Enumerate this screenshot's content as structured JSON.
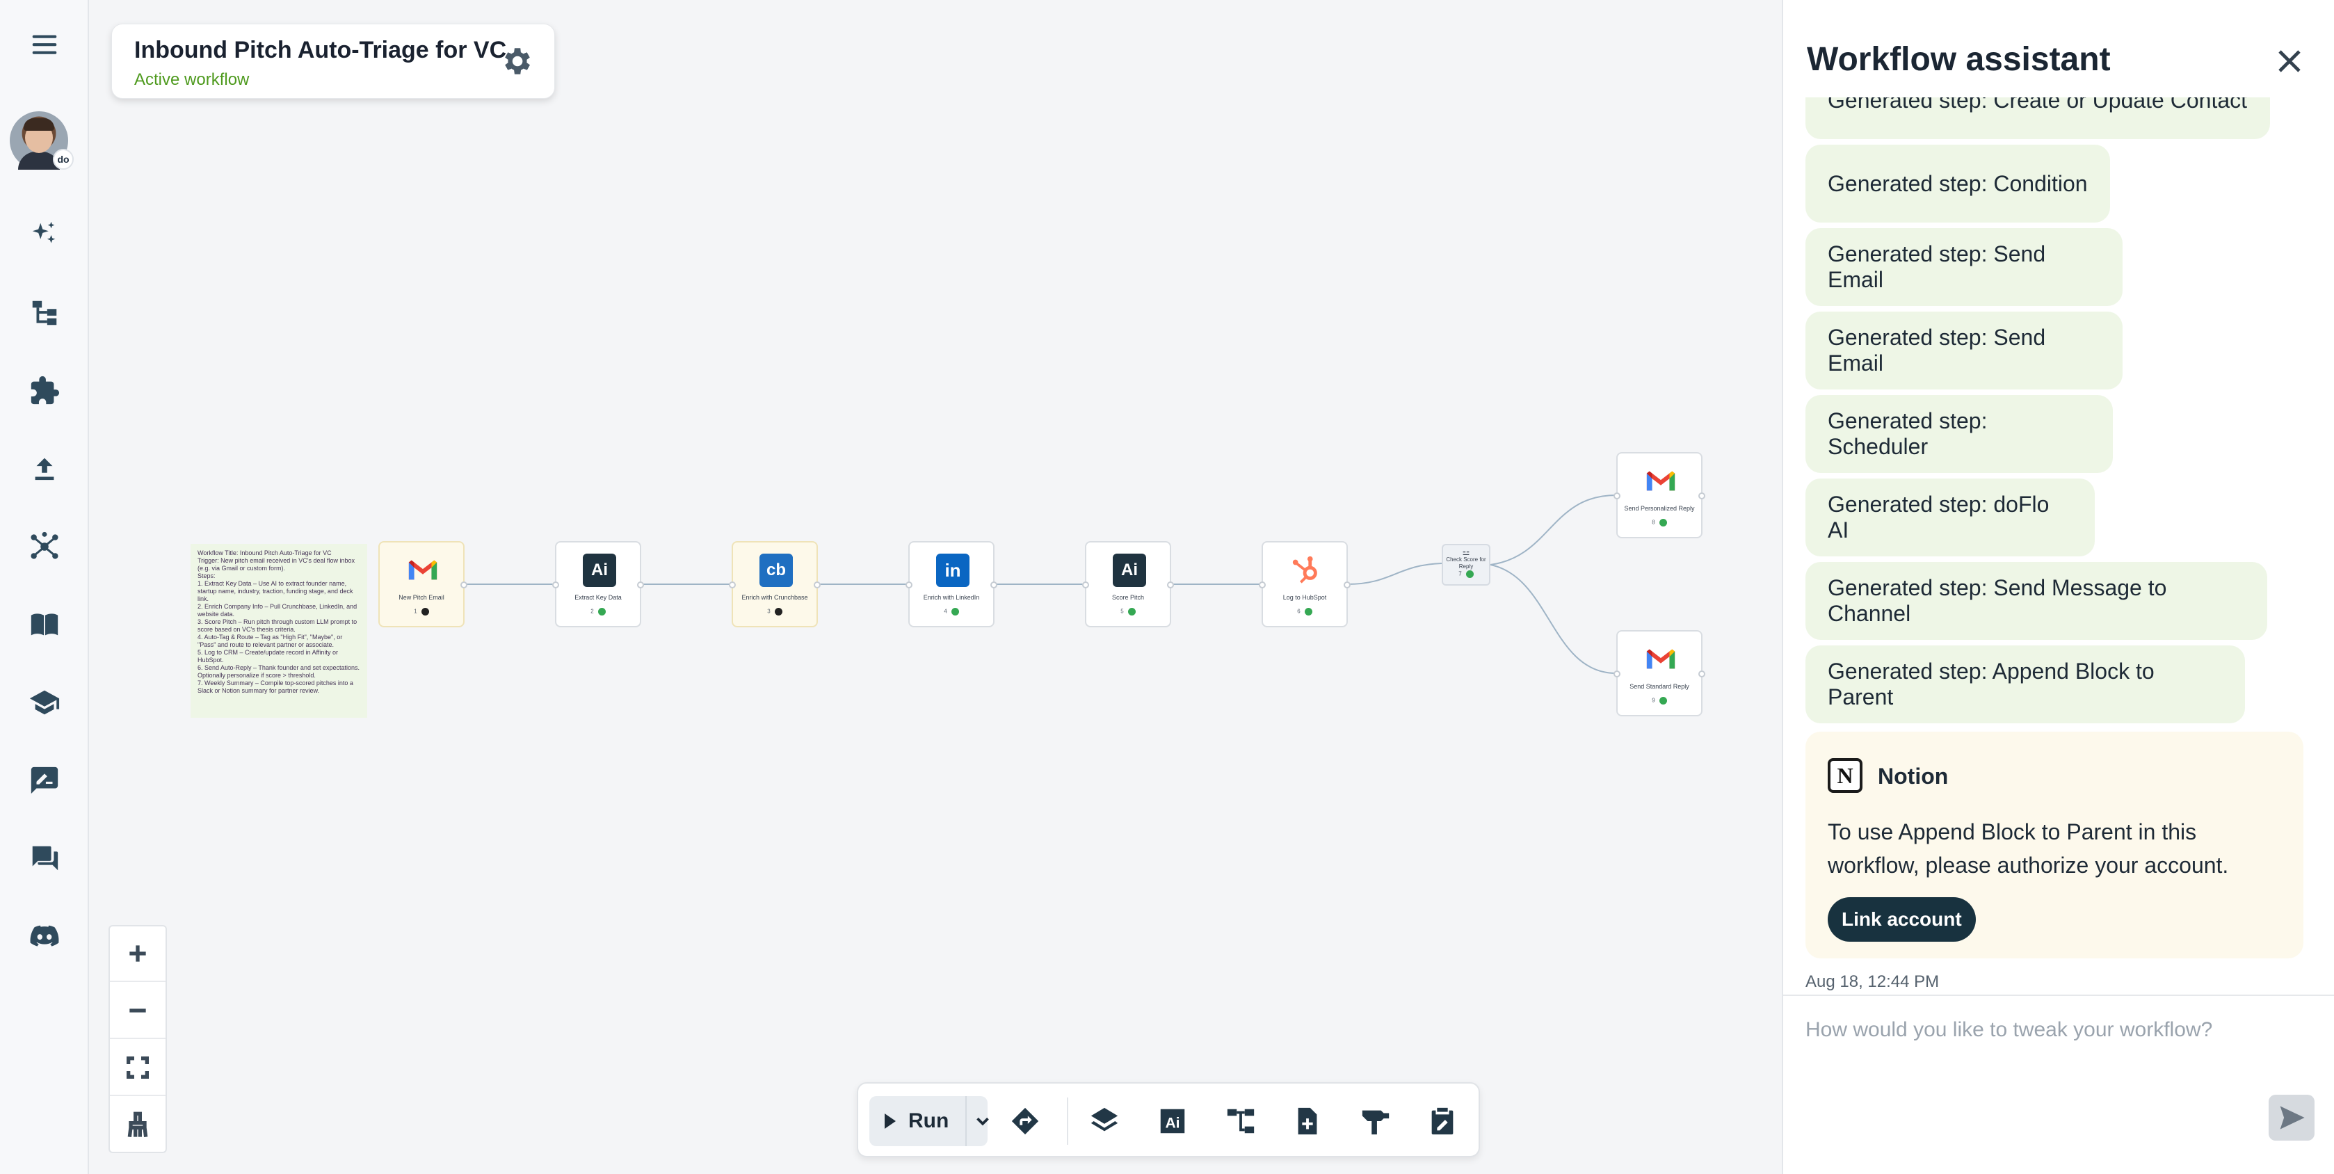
{
  "workflow": {
    "title": "Inbound Pitch Auto-Triage for VC",
    "status": "Active workflow"
  },
  "sidebar": {
    "items": [
      {
        "icon": "menu-icon"
      },
      {
        "icon": "sparkle-icon"
      },
      {
        "icon": "workflow-tree-icon"
      },
      {
        "icon": "puzzle-icon"
      },
      {
        "icon": "upload-icon"
      },
      {
        "icon": "network-icon"
      },
      {
        "icon": "book-icon"
      },
      {
        "icon": "graduation-cap-icon"
      },
      {
        "icon": "sign-icon"
      },
      {
        "icon": "chat-icon"
      },
      {
        "icon": "discord-icon"
      }
    ],
    "avatar_badge": "do"
  },
  "note": {
    "lines": [
      "Workflow Title: Inbound Pitch Auto-Triage for VC",
      "",
      "Trigger: New pitch email received in VC's deal flow inbox (e.g. via Gmail or custom form).",
      "",
      "Steps:",
      "1. Extract Key Data – Use AI to extract founder name, startup name, industry, traction, funding stage, and deck link.",
      "2. Enrich Company Info – Pull Crunchbase, LinkedIn, and website data.",
      "3. Score Pitch – Run pitch through custom LLM prompt to score based on VC's thesis criteria.",
      "4. Auto-Tag & Route – Tag as \"High Fit\", \"Maybe\", or \"Pass\" and route to relevant partner or associate.",
      "5. Log to CRM – Create/update record in Affinity or HubSpot.",
      "6. Send Auto-Reply – Thank founder and set expectations. Optionally personalize if score > threshold.",
      "7. Weekly Summary – Compile top-scored pitches into a Slack or Notion summary for partner review."
    ]
  },
  "nodes": [
    {
      "label": "New Pitch Email",
      "step": "1",
      "status": "pending",
      "icon": "gmail-icon"
    },
    {
      "label": "Extract Key Data",
      "step": "2",
      "status": "ok",
      "icon": "ai-icon"
    },
    {
      "label": "Enrich with Crunchbase",
      "step": "3",
      "status": "pending",
      "icon": "crunchbase-icon"
    },
    {
      "label": "Enrich with LinkedIn",
      "step": "4",
      "status": "ok",
      "icon": "linkedin-icon"
    },
    {
      "label": "Score Pitch",
      "step": "5",
      "status": "ok",
      "icon": "ai-icon"
    },
    {
      "label": "Log to HubSpot",
      "step": "6",
      "status": "ok",
      "icon": "hubspot-icon"
    }
  ],
  "condition": {
    "label": "Check Score for Reply",
    "step": "7"
  },
  "branches": [
    {
      "label": "Send Personalized Reply",
      "step": "8",
      "status": "ok"
    },
    {
      "label": "Send Standard Reply",
      "step": "9",
      "status": "ok"
    }
  ],
  "toolbar": {
    "run_label": "Run",
    "tools": [
      "redirect-icon",
      "layers-icon",
      "ai-text-icon",
      "tree-icon",
      "document-add-icon",
      "hammer-icon",
      "clipboard-edit-icon"
    ]
  },
  "assistant": {
    "title": "Workflow assistant",
    "messages": [
      "Generated step: Create or Update Contact",
      "Generated step: Condition",
      "Generated step: Send Email",
      "Generated step: Send Email",
      "Generated step: Scheduler",
      "Generated step: doFlo AI",
      "Generated step: Send Message to Channel",
      "Generated step: Append Block to Parent"
    ],
    "auth_card": {
      "service": "Notion",
      "logo_letter": "N",
      "text": "To use Append Block to Parent in this workflow, please authorize your account.",
      "button": "Link account"
    },
    "timestamp": "Aug 18, 12:44 PM",
    "input_placeholder": "How would you like to tweak your workflow?"
  }
}
